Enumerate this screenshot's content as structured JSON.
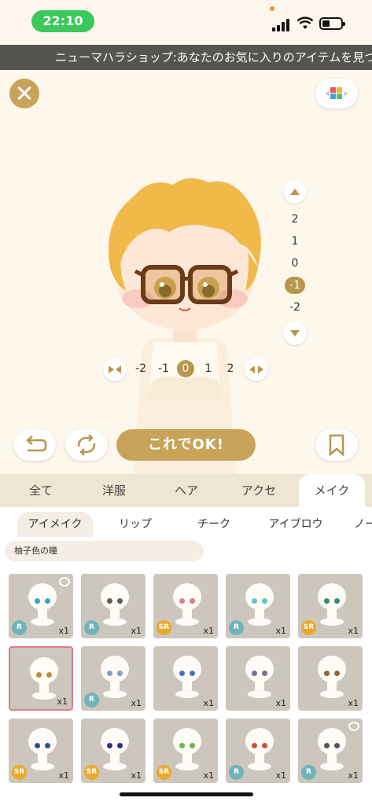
{
  "status": {
    "time": "22:10"
  },
  "ticker": "ニューマハラショップ:あなたのお気に入りのアイテムを見つ",
  "vertical_adjust": {
    "values": [
      "2",
      "1",
      "0",
      "-1",
      "-2"
    ],
    "selected": "-1"
  },
  "horizontal_adjust": {
    "values": [
      "-2",
      "-1",
      "0",
      "1",
      "2"
    ],
    "selected": "0"
  },
  "ok_label": "これでOK!",
  "category_tabs": [
    {
      "label": "全て"
    },
    {
      "label": "洋服"
    },
    {
      "label": "ヘア"
    },
    {
      "label": "アクセ"
    },
    {
      "label": "メイク"
    }
  ],
  "active_category": "メイク",
  "sub_tabs": [
    {
      "label": "アイメイク"
    },
    {
      "label": "リップ"
    },
    {
      "label": "チーク"
    },
    {
      "label": "アイブロウ"
    },
    {
      "label": "ノー"
    }
  ],
  "active_sub_tab": "アイメイク",
  "filter_label": "柚子色の瞳",
  "items": [
    {
      "rarity": "R",
      "qty": "x1",
      "eye_color": "#3aa6c8",
      "bear": true
    },
    {
      "rarity": "R",
      "qty": "x1",
      "eye_color": "#6b5a55",
      "bear": false
    },
    {
      "rarity": "SR",
      "qty": "x1",
      "eye_color": "#e07a95",
      "bear": false
    },
    {
      "rarity": "R",
      "qty": "x1",
      "eye_color": "#5fc7c4",
      "bear": false
    },
    {
      "rarity": "SR",
      "qty": "x1",
      "eye_color": "#3b8a6e",
      "bear": false
    },
    {
      "rarity": "",
      "qty": "x1",
      "eye_color": "#c08a3e",
      "bear": false,
      "selected": true
    },
    {
      "rarity": "R",
      "qty": "x1",
      "eye_color": "#8aa0b8",
      "bear": false
    },
    {
      "rarity": "",
      "qty": "x1",
      "eye_color": "#4a6ed0",
      "bear": false
    },
    {
      "rarity": "",
      "qty": "x1",
      "eye_color": "#7a6f8c",
      "bear": false
    },
    {
      "rarity": "",
      "qty": "x1",
      "eye_color": "#8a6a3e",
      "bear": false
    },
    {
      "rarity": "SR",
      "qty": "x1",
      "eye_color": "#2f4fa0",
      "bear": false
    },
    {
      "rarity": "SR",
      "qty": "x1",
      "eye_color": "#2c2f8a",
      "bear": false
    },
    {
      "rarity": "SR",
      "qty": "x1",
      "eye_color": "#6ab84a",
      "bear": false
    },
    {
      "rarity": "R",
      "qty": "x1",
      "eye_color": "#c8502a",
      "bear": false
    },
    {
      "rarity": "R",
      "qty": "x1",
      "eye_color": "#555555",
      "bear": true
    }
  ],
  "colors": {
    "gold": "#c8a45a",
    "rarity_r": "#6fb4b8",
    "rarity_sr": "#e8a92a",
    "selected_border": "#e07b8f"
  }
}
